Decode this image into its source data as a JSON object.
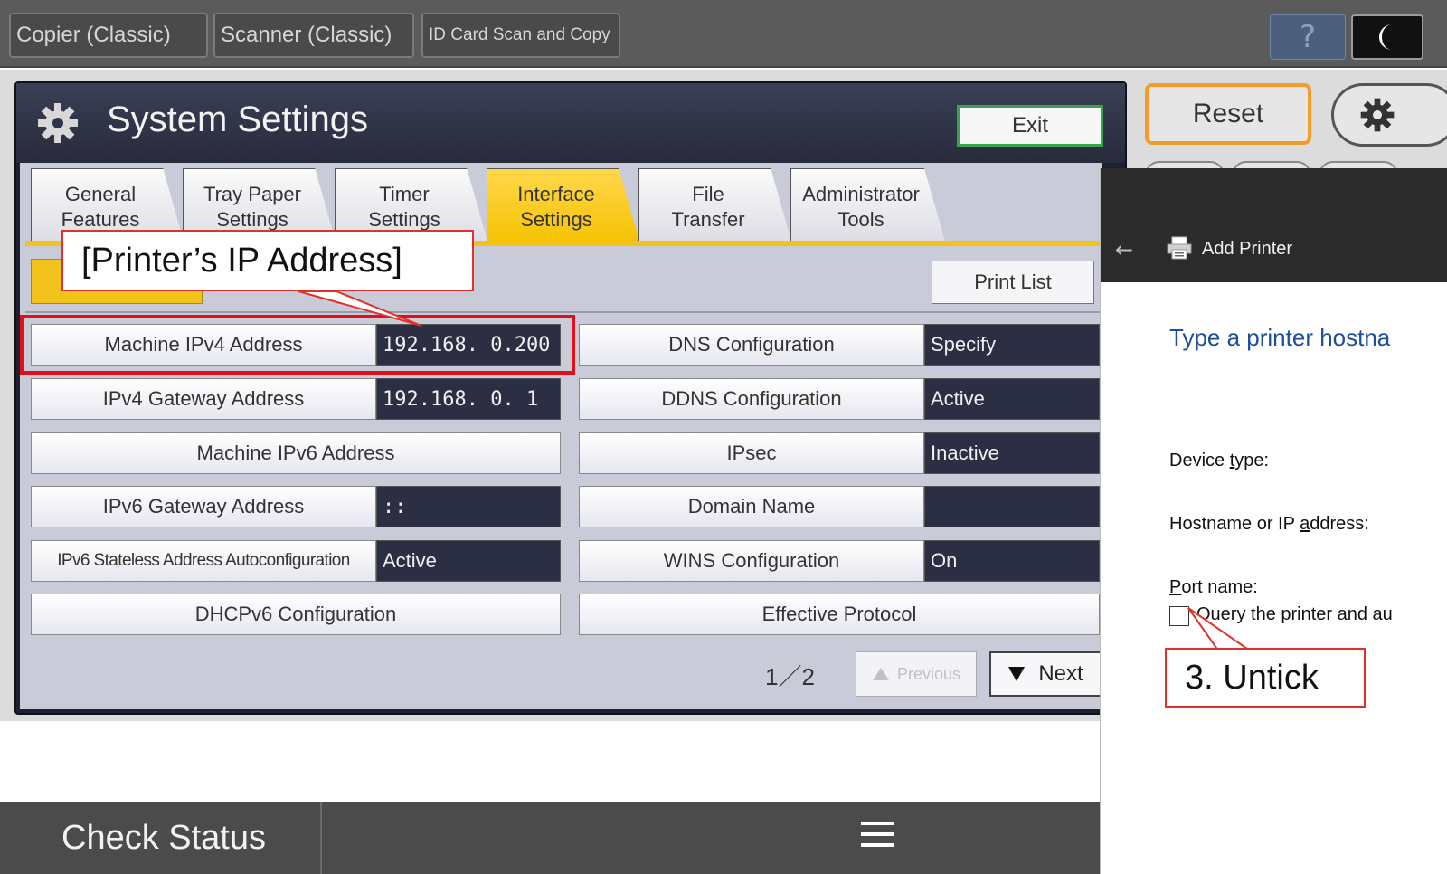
{
  "topbar": {
    "tabs": [
      {
        "label": "Copier (Classic)"
      },
      {
        "label": "Scanner (Classic)"
      },
      {
        "label": "ID Card Scan and Copy"
      }
    ],
    "help_label": "?"
  },
  "system_settings": {
    "title": "System Settings",
    "exit_label": "Exit",
    "tabs": [
      {
        "line1": "General",
        "line2": "Features"
      },
      {
        "line1": "Tray Paper",
        "line2": "Settings"
      },
      {
        "line1": "Timer",
        "line2": "Settings"
      },
      {
        "line1": "Interface",
        "line2": "Settings",
        "active": true
      },
      {
        "line1": "File",
        "line2": "Transfer"
      },
      {
        "line1": "Administrator",
        "line2": "Tools"
      }
    ],
    "print_list_label": "Print List",
    "left_rows": [
      {
        "label": "Machine IPv4 Address",
        "value": "192.168.  0.200"
      },
      {
        "label": "IPv4 Gateway Address",
        "value": "192.168.  0.  1"
      },
      {
        "label": "Machine IPv6 Address",
        "value": null
      },
      {
        "label": "IPv6 Gateway Address",
        "value": "::"
      },
      {
        "label": "IPv6 Stateless Address Autoconfiguration",
        "value": "Active"
      },
      {
        "label": "DHCPv6 Configuration",
        "value": null
      }
    ],
    "right_rows": [
      {
        "label": "DNS Configuration",
        "value": "Specify"
      },
      {
        "label": "DDNS Configuration",
        "value": "Active"
      },
      {
        "label": "IPsec",
        "value": "Inactive"
      },
      {
        "label": "Domain Name",
        "value": ""
      },
      {
        "label": "WINS Configuration",
        "value": "On"
      },
      {
        "label": "Effective Protocol",
        "value": null
      }
    ],
    "pager": {
      "text": "1／2",
      "previous_label": "Previous",
      "next_label": "Next"
    }
  },
  "side_controls": {
    "reset_label": "Reset"
  },
  "add_printer": {
    "title": "Add Printer",
    "heading": "Type a printer hostna",
    "device_type_label": "Device type:",
    "hostname_label": "Hostname or IP address:",
    "port_name_label": "Port name:",
    "query_label": "Query the printer and au",
    "query_checked": false
  },
  "bottombar": {
    "check_status_label": "Check Status"
  },
  "annotations": {
    "ip_callout": "[Printer’s IP Address]",
    "untick_callout": "3. Untick",
    "color": "#e0322b"
  },
  "colors": {
    "accent_yellow": "#f2c31a",
    "reset_border": "#f49b2c",
    "exit_border": "#3aa24a",
    "dialog_heading": "#1f4e9a"
  }
}
